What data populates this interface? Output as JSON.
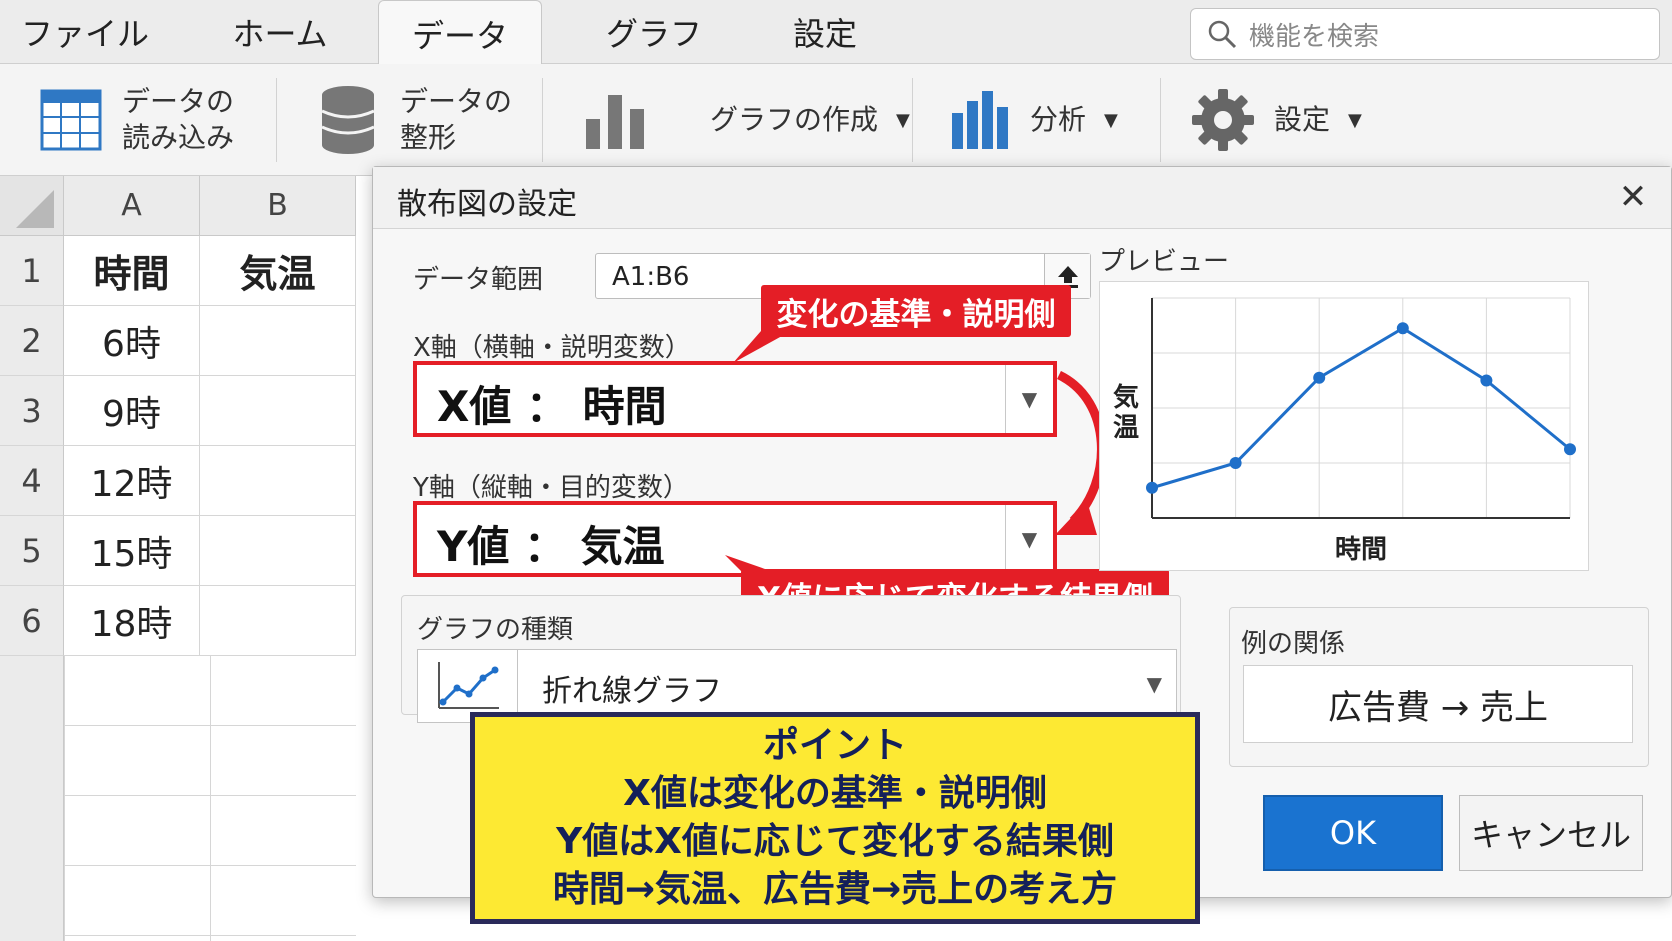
{
  "menu": {
    "tabs": [
      {
        "label": "ファイル"
      },
      {
        "label": "ホーム"
      },
      {
        "label": "データ",
        "active": true
      },
      {
        "label": "グラフ"
      },
      {
        "label": "設定"
      }
    ],
    "search_placeholder": "機能を検索"
  },
  "ribbon": {
    "load_data": {
      "line1": "データの",
      "line2": "読み込み"
    },
    "shape_data": {
      "line1": "データの",
      "line2": "整形"
    },
    "create_chart": "グラフの作成",
    "analysis": "分析",
    "settings": "設定"
  },
  "sheet": {
    "columns": [
      "A",
      "B"
    ],
    "rows": [
      {
        "num": "1",
        "a": "時間",
        "b": "気温"
      },
      {
        "num": "2",
        "a": "6時",
        "b": ""
      },
      {
        "num": "3",
        "a": "9時",
        "b": ""
      },
      {
        "num": "4",
        "a": "12時",
        "b": ""
      },
      {
        "num": "5",
        "a": "15時",
        "b": ""
      },
      {
        "num": "6",
        "a": "18時",
        "b": ""
      }
    ]
  },
  "dialog": {
    "title": "散布図の設定",
    "range_label": "データ範囲",
    "range_value": "A1:B6",
    "x_axis_label": "X軸（横軸・説明変数）",
    "x_value": "X値 ： 時間",
    "y_axis_label": "Y軸（縦軸・目的変数）",
    "y_value": "Y値 ： 気温",
    "callout_x": "変化の基準・説明側",
    "callout_y": "X値に応じて変化する結果側",
    "chart_type_label": "グラフの種類",
    "chart_type_value": "折れ線グラフ",
    "preview_label": "プレビュー",
    "example_label": "例の関係",
    "example_value": "広告費 → 売上",
    "ok": "OK",
    "cancel": "キャンセル"
  },
  "chart_data": {
    "type": "line",
    "xlabel": "時間",
    "ylabel": "気温",
    "x": [
      1,
      2,
      3,
      4,
      5,
      6
    ],
    "values": [
      1.1,
      2.0,
      5.1,
      6.9,
      5.0,
      2.5
    ],
    "grid": true,
    "color": "#1f6fc9"
  },
  "point": {
    "lines": [
      "ポイント",
      "X値は変化の基準・説明側",
      "Y値はX値に応じて変化する結果側",
      "時間→気温、広告費→売上の考え方"
    ]
  },
  "colors": {
    "accent_red": "#e41e26",
    "ok_blue": "#1a73d0",
    "point_yellow": "#fde933"
  }
}
